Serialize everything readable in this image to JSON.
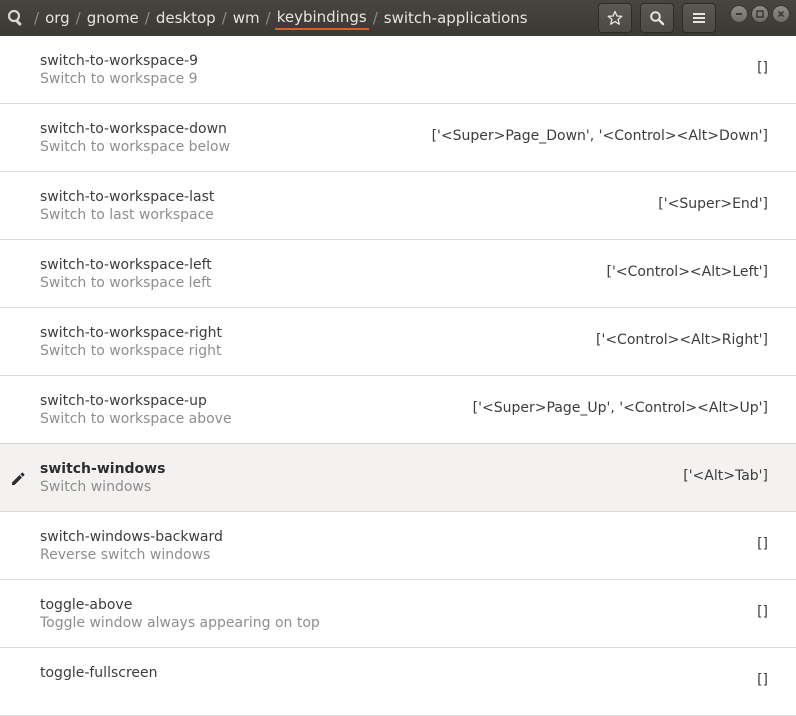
{
  "header": {
    "app_icon": "dconf-editor-icon",
    "breadcrumbs": [
      {
        "label": "/"
      },
      {
        "label": "org"
      },
      {
        "label": "gnome"
      },
      {
        "label": "desktop"
      },
      {
        "label": "wm"
      },
      {
        "label": "keybindings"
      },
      {
        "label": "switch-applications"
      }
    ],
    "buttons": {
      "bookmark_icon": "star-icon",
      "search_icon": "search-icon",
      "menu_icon": "hamburger-menu-icon"
    },
    "window_controls": [
      "minimize",
      "maximize",
      "close"
    ]
  },
  "keys": [
    {
      "name": "switch-to-workspace-9",
      "summary": "Switch to workspace 9",
      "value": "[]"
    },
    {
      "name": "switch-to-workspace-down",
      "summary": "Switch to workspace below",
      "value": "['<Super>Page_Down', '<Control><Alt>Down']"
    },
    {
      "name": "switch-to-workspace-last",
      "summary": "Switch to last workspace",
      "value": "['<Super>End']"
    },
    {
      "name": "switch-to-workspace-left",
      "summary": "Switch to workspace left",
      "value": "['<Control><Alt>Left']"
    },
    {
      "name": "switch-to-workspace-right",
      "summary": "Switch to workspace right",
      "value": "['<Control><Alt>Right']"
    },
    {
      "name": "switch-to-workspace-up",
      "summary": "Switch to workspace above",
      "value": "['<Super>Page_Up', '<Control><Alt>Up']"
    },
    {
      "name": "switch-windows",
      "summary": "Switch windows",
      "value": "['<Alt>Tab']",
      "selected": true
    },
    {
      "name": "switch-windows-backward",
      "summary": "Reverse switch windows",
      "value": "[]"
    },
    {
      "name": "toggle-above",
      "summary": "Toggle window always appearing on top",
      "value": "[]"
    },
    {
      "name": "toggle-fullscreen",
      "summary": "",
      "value": "[]"
    }
  ],
  "colors": {
    "headerbar": "#3a3935",
    "accent_underline": "#e05a2f",
    "selected_row": "#f3f2f1"
  }
}
